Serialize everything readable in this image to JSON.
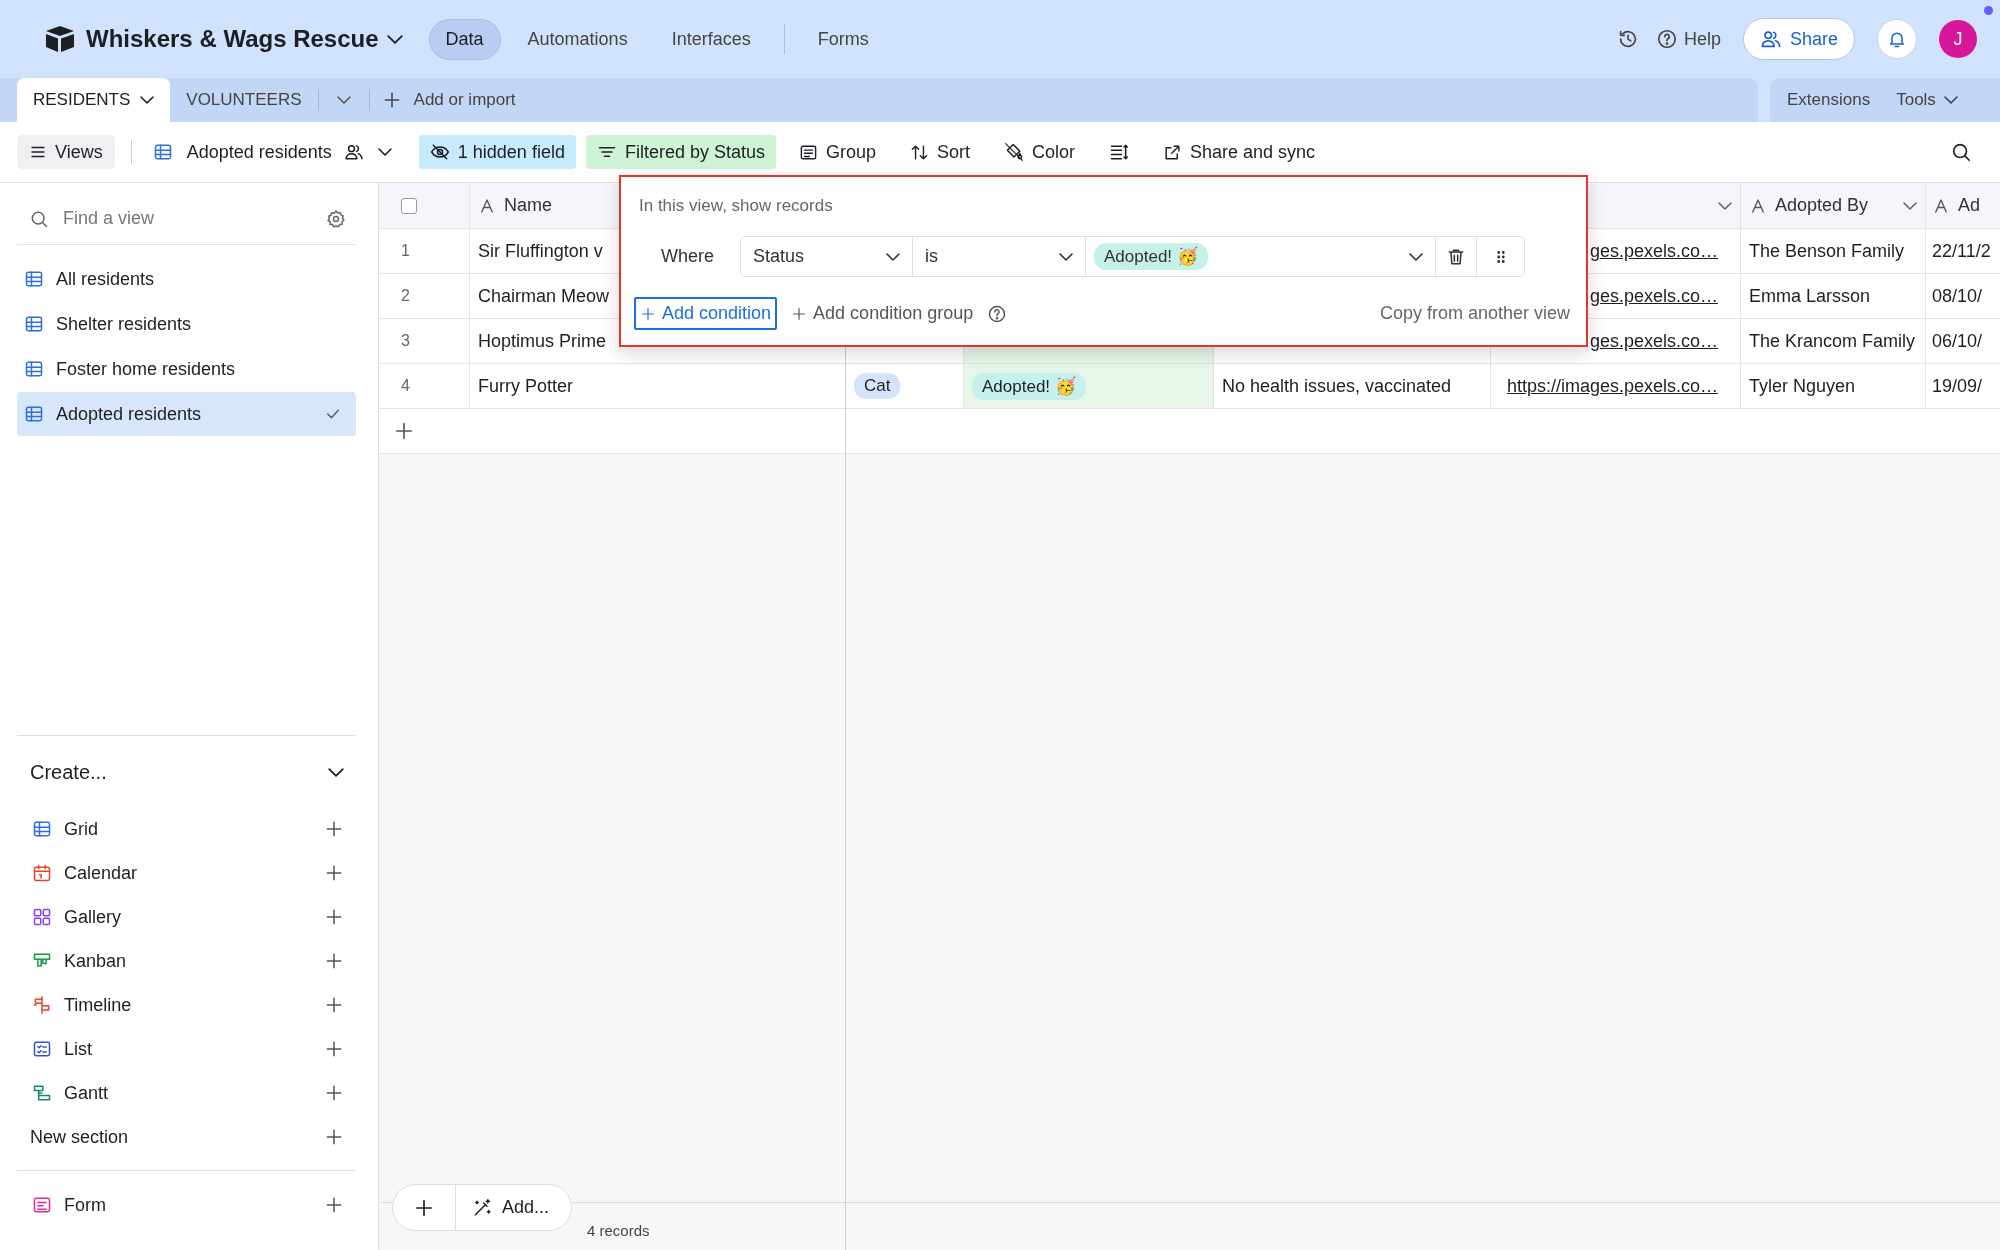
{
  "topbar": {
    "base_name": "Whiskers & Wags Rescue",
    "nav": [
      {
        "label": "Data",
        "selected": true,
        "divider_before": false
      },
      {
        "label": "Automations",
        "selected": false,
        "divider_before": false
      },
      {
        "label": "Interfaces",
        "selected": false,
        "divider_before": false
      },
      {
        "label": "Forms",
        "selected": false,
        "divider_before": true
      }
    ],
    "help": "Help",
    "share": "Share",
    "avatar": "J"
  },
  "tables": {
    "items": [
      {
        "label": "RESIDENTS",
        "selected": true
      },
      {
        "label": "VOLUNTEERS",
        "selected": false
      }
    ],
    "add": "Add or import",
    "extensions": "Extensions",
    "tools": "Tools"
  },
  "toolbar": {
    "views": "Views",
    "view_name": "Adopted residents",
    "hidden_fields": "1 hidden field",
    "filter": "Filtered by Status",
    "group": "Group",
    "sort": "Sort",
    "color_button": "Color",
    "share_sync": "Share and sync"
  },
  "sidebar": {
    "search_placeholder": "Find a view",
    "views": [
      {
        "label": "All residents",
        "selected": false
      },
      {
        "label": "Shelter residents",
        "selected": false
      },
      {
        "label": "Foster home residents",
        "selected": false
      },
      {
        "label": "Adopted residents",
        "selected": true
      }
    ],
    "create_title": "Create...",
    "create": [
      {
        "label": "Grid",
        "kind": "grid"
      },
      {
        "label": "Calendar",
        "kind": "calendar"
      },
      {
        "label": "Gallery",
        "kind": "gallery"
      },
      {
        "label": "Kanban",
        "kind": "kanban"
      },
      {
        "label": "Timeline",
        "kind": "timeline"
      },
      {
        "label": "List",
        "kind": "list"
      },
      {
        "label": "Gantt",
        "kind": "gantt"
      },
      {
        "label": "New section",
        "kind": "section"
      }
    ],
    "forms": [
      {
        "label": "Form",
        "kind": "form"
      }
    ]
  },
  "grid": {
    "select_all_checked": false,
    "columns": [
      {
        "label": "Name",
        "menu": false,
        "filtered": false
      },
      {
        "filtered": false
      },
      {
        "filtered": true
      },
      {
        "filtered": false
      },
      {
        "menu": true,
        "filtered": false
      },
      {
        "label": "Adopted By",
        "menu": true,
        "filtered": false
      },
      {
        "label": "Ad",
        "menu": false,
        "filtered": false
      }
    ],
    "rows": [
      {
        "number": "1",
        "name": "Sir Fluffington v",
        "photo": "ges.pexels.co…",
        "adopted_by": "The Benson Family",
        "date": "22/11/2"
      },
      {
        "number": "2",
        "name": "Chairman Meow",
        "photo": "ges.pexels.co…",
        "adopted_by": "Emma Larsson",
        "date": "08/10/"
      },
      {
        "number": "3",
        "name": "Hoptimus Prime",
        "photo": "ges.pexels.co…",
        "adopted_by": "The Krancom Family",
        "date": "06/10/"
      },
      {
        "number": "4",
        "name": "Furry Potter",
        "species": "Cat",
        "status": "Adopted! 🥳",
        "notes": "No health issues, vaccinated",
        "photo": "https://images.pexels.co…",
        "adopted_by": "Tyler Nguyen",
        "date": "19/09/"
      }
    ],
    "add_button": "Add...",
    "record_count": "4 records"
  },
  "filter_popup": {
    "title": "In this view, show records",
    "conditions": [
      {
        "conjunction": "Where",
        "field": "Status",
        "operator": "is",
        "value": "Adopted! 🥳"
      }
    ],
    "add_condition": "Add condition",
    "add_group": "Add condition group",
    "copy": "Copy from another view"
  }
}
